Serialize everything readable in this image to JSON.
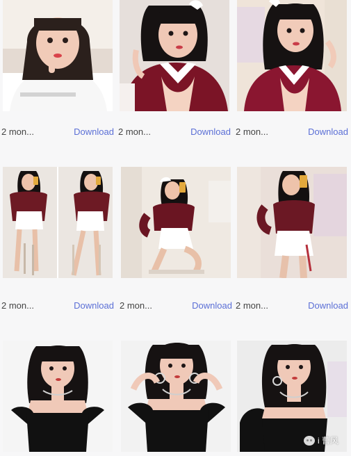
{
  "grid": {
    "items": [
      {
        "time": "2 mon...",
        "download": "Download",
        "image": "girl-selfie-white-tshirt",
        "colors": [
          "#f2ece8",
          "#f6f6f6",
          "#2a1d1a",
          "#f0c9b8",
          "#d04a4a"
        ]
      },
      {
        "time": "2 mon...",
        "download": "Download",
        "image": "maid-selfie-red-velvet",
        "colors": [
          "#e9e2de",
          "#7b1426",
          "#1a1414",
          "#f1cbb9",
          "#ffffff"
        ]
      },
      {
        "time": "2 mon...",
        "download": "Download",
        "image": "maid-selfie-red-velvet-2",
        "colors": [
          "#efe3d8",
          "#8a1630",
          "#1a1414",
          "#f1cbb9",
          "#ffffff"
        ]
      },
      {
        "time": "2 mon...",
        "download": "Download",
        "image": "maid-mirror-full-body",
        "colors": [
          "#ece8e4",
          "#6d1a24",
          "#1a1414",
          "#e8c0a8",
          "#ffffff"
        ]
      },
      {
        "time": "2 mon...",
        "download": "Download",
        "image": "maid-kneeling-phone",
        "colors": [
          "#f2ece4",
          "#6a1522",
          "#1a1414",
          "#e8c0a8",
          "#ffffff"
        ]
      },
      {
        "time": "2 mon...",
        "download": "Download",
        "image": "maid-mirror-half-body",
        "colors": [
          "#ebe1dc",
          "#6b1824",
          "#1a1414",
          "#e7c1ab",
          "#ffffff"
        ]
      },
      {
        "time": "",
        "download": "",
        "image": "girl-black-dress-front",
        "colors": [
          "#f4f4f4",
          "#111111",
          "#1a1414",
          "#f0c9b8",
          "#c33b3b"
        ]
      },
      {
        "time": "",
        "download": "",
        "image": "girl-black-dress-hands",
        "colors": [
          "#f2f2f2",
          "#111111",
          "#1a1414",
          "#f0c9b8",
          "#c33b3b"
        ]
      },
      {
        "time": "",
        "download": "",
        "image": "girl-black-dress-side",
        "colors": [
          "#eeeeee",
          "#111111",
          "#1a1414",
          "#f0c9b8",
          "#c33b3b"
        ]
      }
    ]
  },
  "watermark": {
    "text": "i 曹风",
    "icon": "wechat-icon"
  }
}
